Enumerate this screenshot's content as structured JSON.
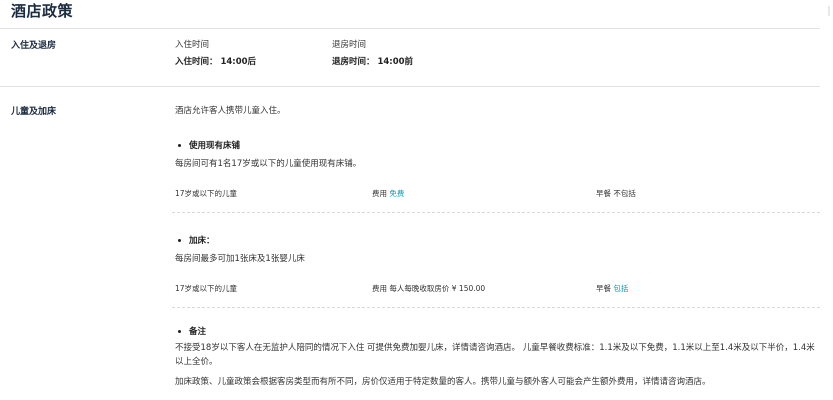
{
  "page": {
    "title": "酒店政策"
  },
  "checkin": {
    "label": "入住及退房",
    "checkin_header": "入住时间",
    "checkin_value": "入住时间： 14:00后",
    "checkout_header": "退房时间",
    "checkout_value": "退房时间： 14:00前"
  },
  "children": {
    "label": "儿童及加床",
    "intro": "酒店允许客人携带儿童入住。",
    "existing_bed": {
      "heading": "使用现有床铺",
      "desc": "每房间可有1名17岁或以下的儿童使用现有床铺。",
      "age": "17岁或以下的儿童",
      "fee_label": "费用",
      "fee_value": "免费",
      "breakfast_label": "早餐",
      "breakfast_value": "不包括"
    },
    "extra_bed": {
      "heading": "加床：",
      "desc": "每房间最多可加1张床及1张婴儿床",
      "age": "17岁或以下的儿童",
      "fee_label": "费用",
      "fee_value": "每人每晚收取房价 ¥ 150.00",
      "breakfast_label": "早餐",
      "breakfast_value": "包括"
    },
    "notes": {
      "heading": "备注",
      "line1": "不接受18岁以下客人在无监护人陪同的情况下入住 可提供免费加婴儿床，详情请咨询酒店。 儿童早餐收费标准：1.1米及以下免费，1.1米以上至1.4米及以下半价，1.4米以上全价。",
      "line2": "加床政策、儿童政策会根据客房类型而有所不同，房价仅适用于特定数量的客人。携带儿童与额外客人可能会产生额外费用，详情请咨询酒店。"
    }
  },
  "colors": {
    "accent": "#0a9bb5",
    "heading": "#1b2b40",
    "divider": "#e2e2e2"
  }
}
